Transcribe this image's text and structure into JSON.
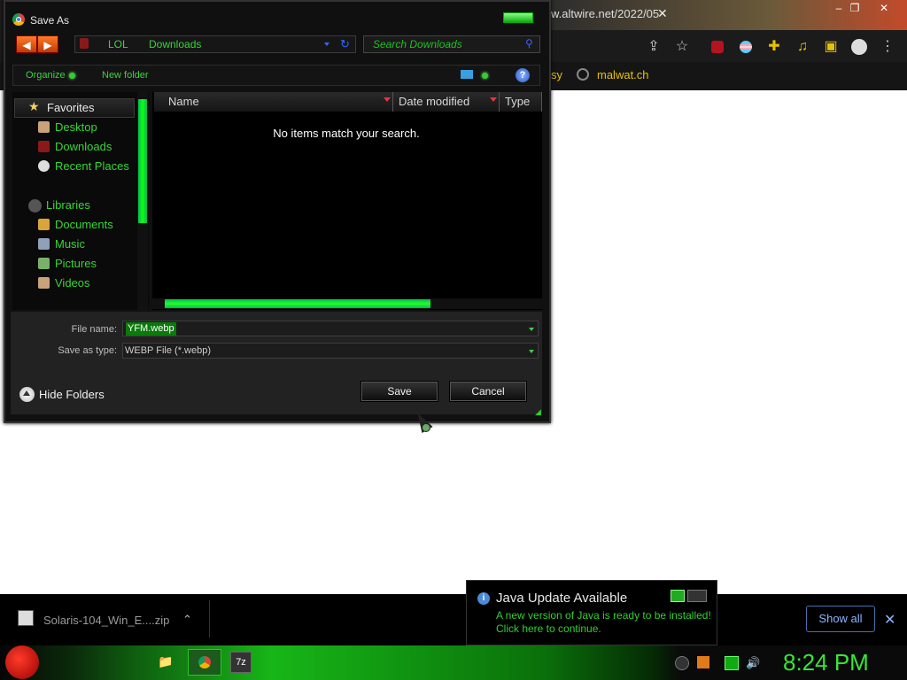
{
  "browser": {
    "tab_url": "w.altwire.net/2022/05",
    "tab_close": "✕",
    "window_buttons": [
      "–",
      "❐",
      "✕"
    ],
    "toolbar_icons": [
      "share-icon",
      "star-icon",
      "ublock-icon",
      "profile-flag-icon",
      "extensions-icon",
      "media-icon",
      "sidepanel-icon",
      "account-icon",
      "menu-icon"
    ],
    "bookmarks": [
      {
        "label": "sy"
      },
      {
        "label": "malwat.ch"
      }
    ]
  },
  "dialog": {
    "title": "Save As",
    "nav": {
      "back": "◀",
      "forward": "▶"
    },
    "breadcrumb": [
      "LOL",
      "Downloads"
    ],
    "search_placeholder": "Search Downloads",
    "commands": {
      "organize": "Organize",
      "new_folder": "New folder",
      "help": "?"
    },
    "sidebar": {
      "favorites_header": "Favorites",
      "favorites": [
        "Desktop",
        "Downloads",
        "Recent Places"
      ],
      "libraries_header": "Libraries",
      "libraries": [
        "Documents",
        "Music",
        "Pictures",
        "Videos"
      ]
    },
    "columns": [
      "Name",
      "Date modified",
      "Type"
    ],
    "empty_message": "No items match your search.",
    "file_name_label": "File name:",
    "file_name_value": "YFM.webp",
    "save_type_label": "Save as type:",
    "save_type_value": "WEBP File (*.webp)",
    "hide_folders": "Hide Folders",
    "save_button": "Save",
    "cancel_button": "Cancel"
  },
  "downloads_bar": {
    "file_name": "Solaris-104_Win_E....zip",
    "chevron": "⌃",
    "show_all": "Show all",
    "close": "✕"
  },
  "java_toast": {
    "title": "Java Update Available",
    "line1": "A new version of Java is ready to be installed!",
    "line2": "Click here to continue."
  },
  "taskbar": {
    "clock": "8:24 PM",
    "explorer_glyph": "📁",
    "sevenzip_glyph": "7z"
  },
  "colors": {
    "accent_green": "#37d637",
    "link_blue": "#8ab4ff",
    "dialog_bg": "#101010"
  }
}
